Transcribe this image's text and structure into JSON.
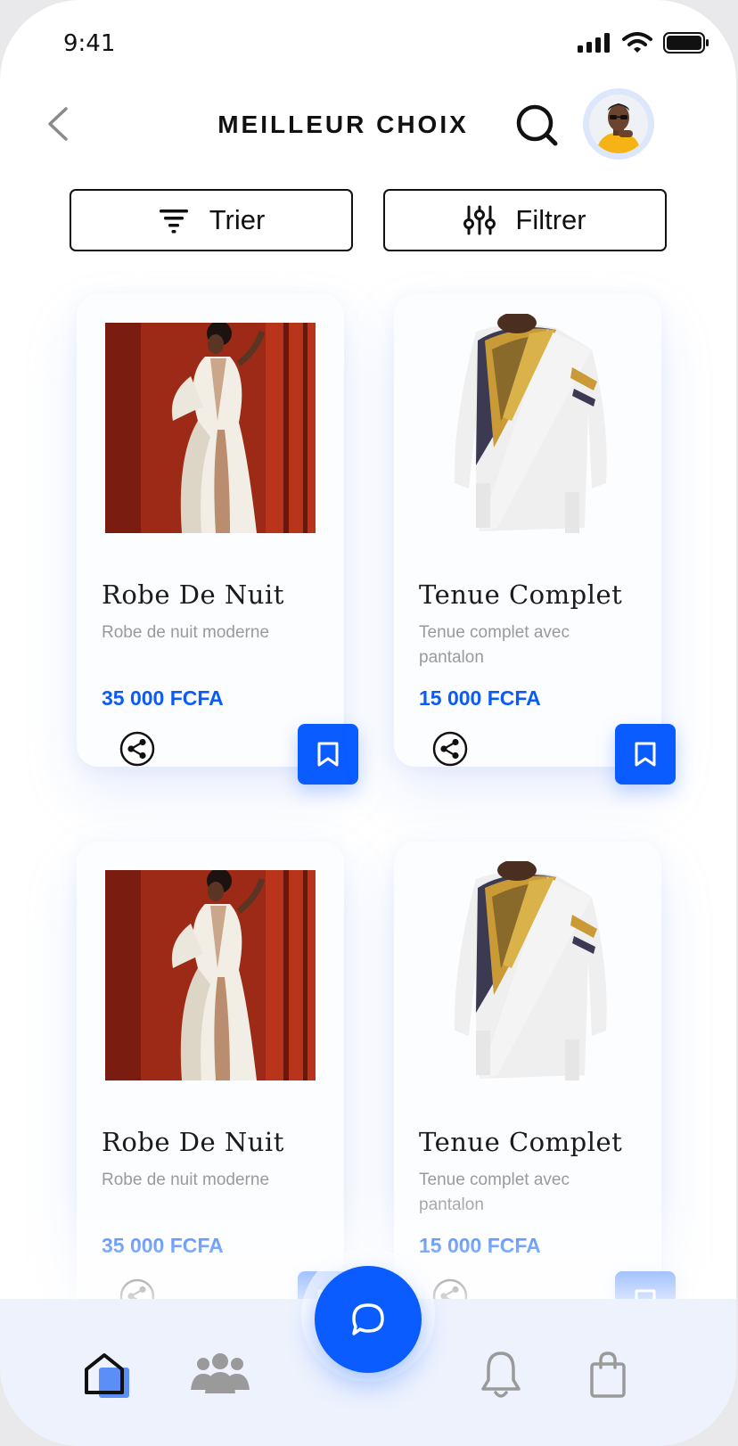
{
  "status_bar": {
    "time": "9:41"
  },
  "header": {
    "title": "MEILLEUR CHOIX"
  },
  "toolbar": {
    "sort_label": "Trier",
    "filter_label": "Filtrer"
  },
  "products": [
    {
      "name": "Robe De Nuit",
      "description": "Robe de nuit moderne",
      "price": "35 000 FCFA",
      "image": "dress-image"
    },
    {
      "name": "Tenue Complet",
      "description": "Tenue complet avec pantalon",
      "price": "15 000 FCFA",
      "image": "shirt-image"
    },
    {
      "name": "Robe De Nuit",
      "description": "Robe de nuit moderne",
      "price": "35 000 FCFA",
      "image": "dress-image"
    },
    {
      "name": "Tenue Complet",
      "description": "Tenue complet avec pantalon",
      "price": "15 000 FCFA",
      "image": "shirt-image"
    }
  ],
  "bottom_nav": {
    "items": [
      "home-icon",
      "community-icon",
      "chat-icon",
      "bell-icon",
      "shopping-bag-icon"
    ],
    "active": "home-icon"
  },
  "colors": {
    "accent": "#0a5cff",
    "price": "#0b5cf5",
    "nav_background": "#edf2fd"
  }
}
